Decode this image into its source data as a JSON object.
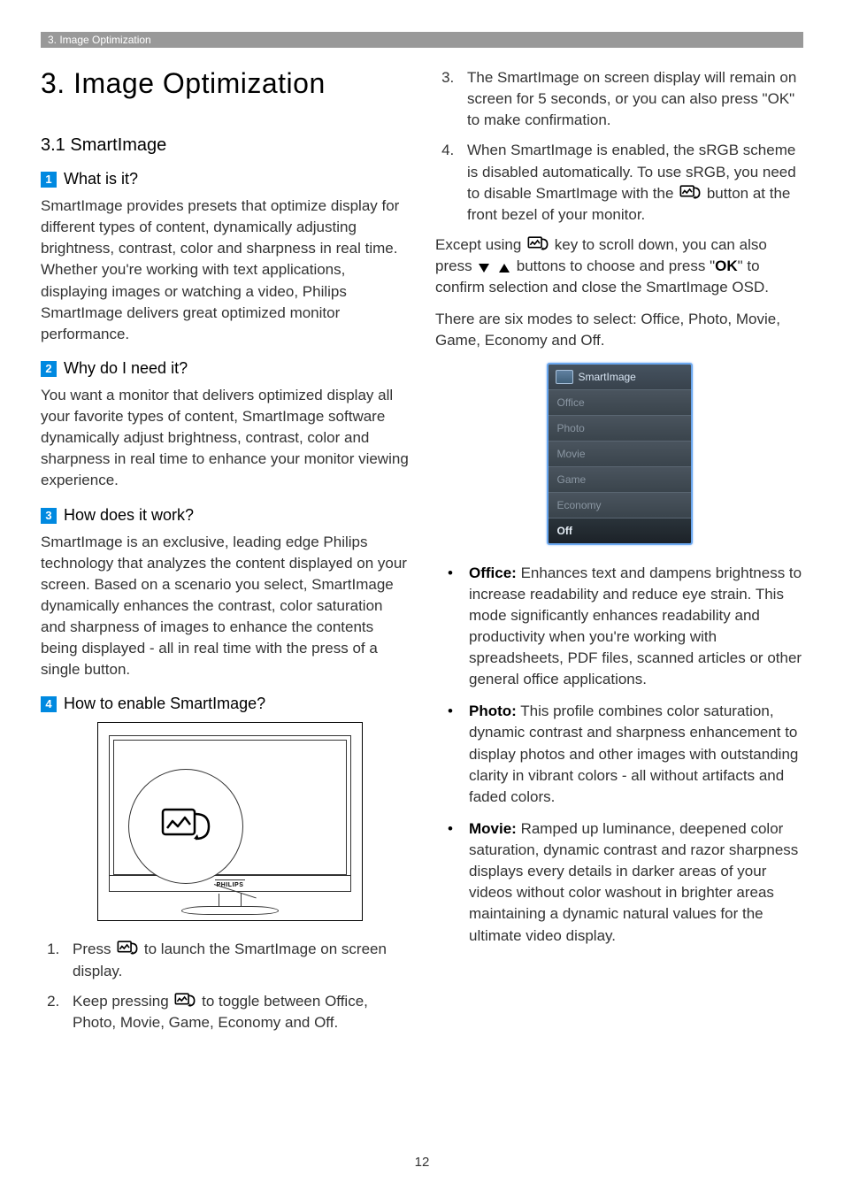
{
  "header": {
    "breadcrumb": "3. Image Optimization"
  },
  "chapter": {
    "title": "3.  Image Optimization"
  },
  "section": {
    "title": "3.1  SmartImage"
  },
  "q1": {
    "num": "1",
    "title": "What is it?",
    "body": "SmartImage provides presets that optimize display for different types of content, dynamically adjusting brightness, contrast, color and sharpness in real time. Whether you're working with text applications, displaying images or watching a video, Philips SmartImage delivers great optimized monitor performance."
  },
  "q2": {
    "num": "2",
    "title": "Why do I need it?",
    "body": "You want a monitor that delivers optimized display all your favorite types of content, SmartImage software dynamically adjust brightness, contrast, color and sharpness in real time to enhance your monitor viewing experience."
  },
  "q3": {
    "num": "3",
    "title": "How does it work?",
    "body": "SmartImage is an exclusive, leading edge Philips technology that analyzes the content displayed on your screen. Based on a scenario you select, SmartImage dynamically enhances the contrast, color saturation and sharpness of images to enhance the contents being displayed - all in real time with the press of a single button."
  },
  "q4": {
    "num": "4",
    "title": "How to enable SmartImage?"
  },
  "monitor_brand": "PHILIPS",
  "steps": {
    "s1_a": "Press ",
    "s1_b": " to launch the SmartImage on screen display.",
    "s2_a": "Keep pressing ",
    "s2_b": " to toggle between Office, Photo, Movie, Game, Economy and Off.",
    "s3": "The SmartImage on screen display will remain on screen for 5 seconds, or you can also press \"OK\" to make confirmation.",
    "s4_a": "When SmartImage is enabled, the sRGB scheme is disabled automatically. To use sRGB, you need to disable SmartImage with the ",
    "s4_b": " button at the front bezel of your monitor."
  },
  "except_para": {
    "a": "Except using ",
    "b": " key to scroll down, you can also press ",
    "c": " buttons to choose and press \"",
    "ok": "OK",
    "d": "\" to confirm selection and close the SmartImage OSD."
  },
  "modes_intro": "There are six modes to select: Office, Photo, Movie, Game, Economy and Off.",
  "osd": {
    "title": "SmartImage",
    "items": [
      "Office",
      "Photo",
      "Movie",
      "Game",
      "Economy",
      "Off"
    ],
    "selected": "Off"
  },
  "mode_desc": {
    "office": {
      "label": "Office:",
      "text": " Enhances text and dampens brightness to increase readability and reduce eye strain. This mode significantly enhances readability and productivity when you're working with spreadsheets, PDF files, scanned articles or other general office applications."
    },
    "photo": {
      "label": "Photo:",
      "text": " This profile combines color saturation, dynamic contrast and sharpness enhancement to display photos and other images with outstanding clarity in vibrant colors - all without artifacts and faded colors."
    },
    "movie": {
      "label": "Movie:",
      "text": " Ramped up luminance, deepened color saturation, dynamic contrast and razor sharpness displays every details in darker areas of your videos without color washout in brighter areas maintaining a dynamic natural values for the ultimate video display."
    }
  },
  "page_number": "12"
}
